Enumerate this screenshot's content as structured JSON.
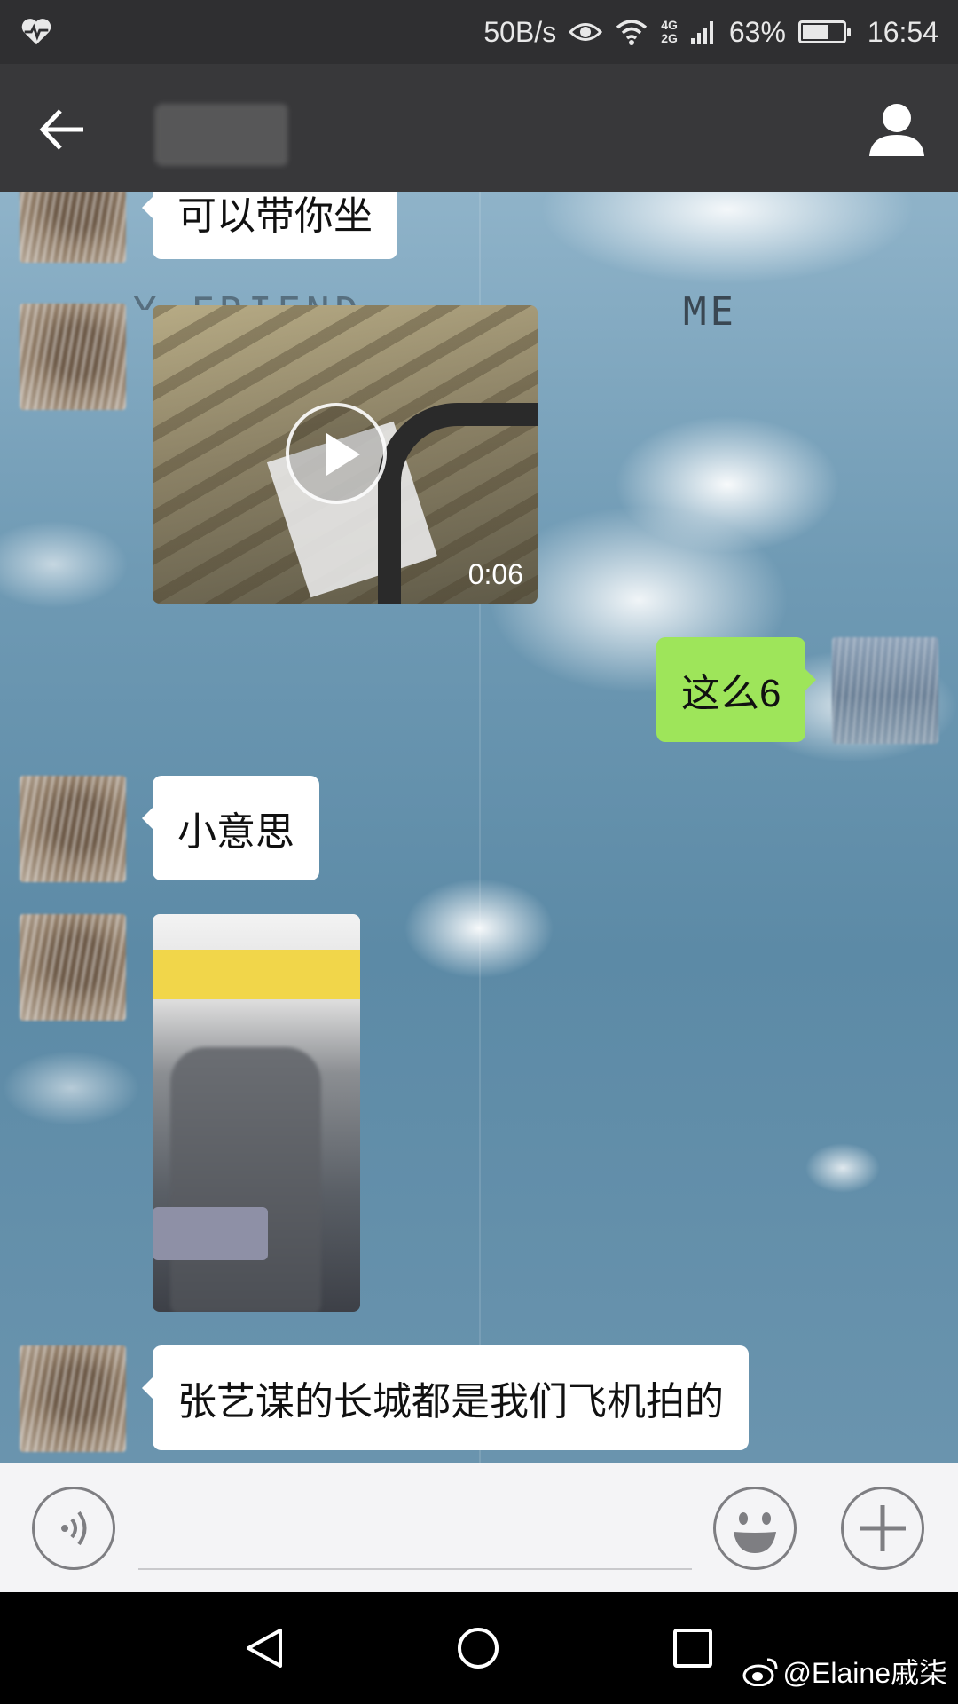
{
  "status_bar": {
    "net_speed": "50B/s",
    "network_type": "4G\n2G",
    "network_type_top": "4G",
    "network_type_bottom": "2G",
    "battery": "63%",
    "battery_level": 0.63,
    "time": "16:54",
    "icons": [
      "heart-monitor-icon",
      "eye-icon",
      "wifi-icon",
      "signal-icon",
      "battery-icon"
    ]
  },
  "header": {
    "back_icon": "arrow-left-icon",
    "profile_icon": "person-icon"
  },
  "chat": {
    "wallpaper_labels": {
      "friend": "Y FRIEND",
      "me": "ME"
    },
    "messages": [
      {
        "from": "friend",
        "type": "text",
        "text": "可以带你坐"
      },
      {
        "from": "friend",
        "type": "video",
        "duration": "0:06"
      },
      {
        "from": "me",
        "type": "text",
        "text": "这么6"
      },
      {
        "from": "friend",
        "type": "text",
        "text": "小意思"
      },
      {
        "from": "friend",
        "type": "image"
      },
      {
        "from": "friend",
        "type": "text",
        "text": "张艺谋的长城都是我们飞机拍的"
      }
    ]
  },
  "input_bar": {
    "voice_icon": "voice-icon",
    "emoji_icon": "smiley-icon",
    "more_icon": "plus-icon",
    "message_value": ""
  },
  "nav_bar": {
    "icons": [
      "back-triangle-icon",
      "home-circle-icon",
      "recents-square-icon"
    ]
  },
  "watermark": {
    "icon": "weibo-icon",
    "text": "@Elaine戚柒"
  },
  "colors": {
    "status_bg": "#2f2f31",
    "header_bg": "#38383a",
    "out_bubble": "#9ee55a",
    "in_bubble": "#ffffff"
  }
}
